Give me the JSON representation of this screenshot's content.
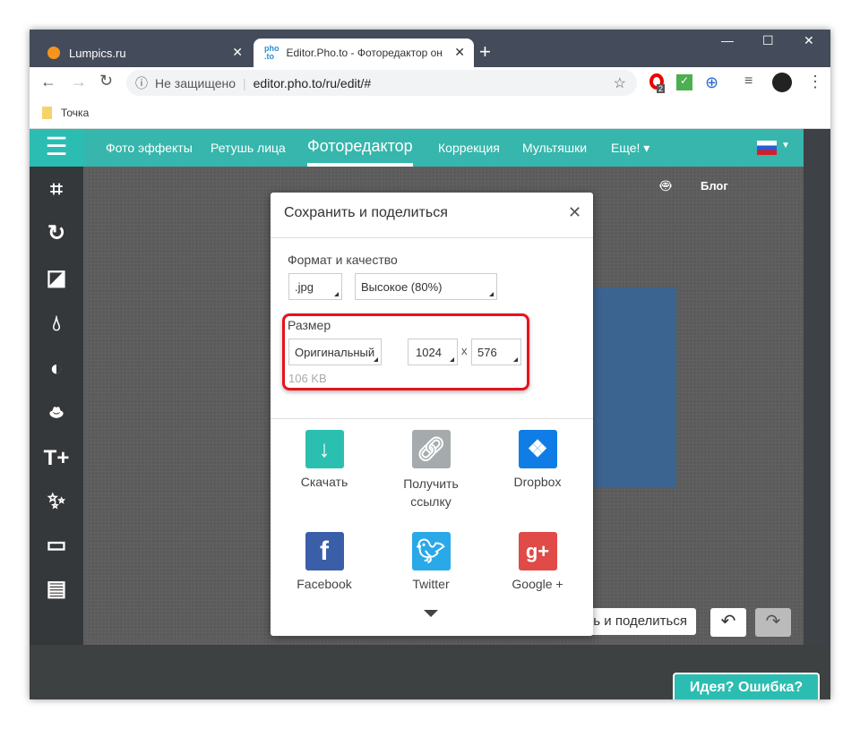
{
  "browser": {
    "tabs": [
      {
        "title": "Lumpics.ru",
        "icon": "orange-icon"
      },
      {
        "title": "Editor.Pho.to - Фоторедактор он",
        "icon": "phototo-icon"
      }
    ],
    "new_tab": "+",
    "address": {
      "security": "Не защищено",
      "url": "editor.pho.to/ru/edit/#"
    },
    "extension_badge": "2",
    "bookmarks": [
      {
        "label": "Точка"
      }
    ]
  },
  "nav": {
    "items": [
      "Фото эффекты",
      "Ретушь лица",
      "Фоторедактор",
      "Коррекция",
      "Мультяшки",
      "Еще! ▾"
    ],
    "active": 2,
    "right_links": {
      "blog": "Блог"
    }
  },
  "sidebar": {
    "tools": [
      "crop-icon",
      "rotate-icon",
      "exposure-icon",
      "color-drop-icon",
      "contrast-icon",
      "hat-mustache-icon",
      "text-add-icon",
      "magic-wand-icon",
      "frame-icon",
      "texture-icon"
    ]
  },
  "dialog": {
    "title": "Сохранить и поделиться",
    "format_label": "Формат и качество",
    "format": ".jpg",
    "quality": "Высокое (80%)",
    "size_label": "Размер",
    "size_mode": "Оригинальный",
    "width": "1024",
    "height": "576",
    "times": "x",
    "file_size": "106 KB",
    "share": [
      {
        "label": "Скачать",
        "color": "#2bbfb0"
      },
      {
        "label": "Получить ссылку",
        "color": "#a5abac"
      },
      {
        "label": "Dropbox",
        "color": "#0f7de5"
      },
      {
        "label": "Facebook",
        "color": "#3b5ea8"
      },
      {
        "label": "Twitter",
        "color": "#29a9e8"
      },
      {
        "label": "Google +",
        "color": "#e04a47"
      }
    ]
  },
  "footer": {
    "save_share": "Сохранить и поделиться",
    "feedback": "Идея? Ошибка?"
  },
  "colors": {
    "accent": "#36b6ac",
    "highlight": "#e8121b"
  }
}
